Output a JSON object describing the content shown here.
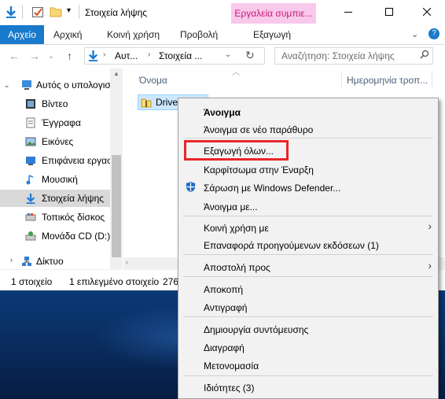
{
  "window": {
    "title": "Στοιχεία λήψης",
    "context_tab_title": "Εργαλεία συμπιε..."
  },
  "ribbon": {
    "tabs": [
      "Αρχείο",
      "Αρχική",
      "Κοινή χρήση",
      "Προβολή",
      "Εξαγωγή"
    ]
  },
  "address": {
    "path_root": "Αυτ...",
    "path_current": "Στοιχεία ...",
    "search_placeholder": "Αναζήτηση: Στοιχεία λήψης"
  },
  "nav_pane": {
    "items": [
      {
        "label": "Αυτός ο υπολογισ",
        "icon": "computer-icon"
      },
      {
        "label": "Βίντεο",
        "icon": "video-icon"
      },
      {
        "label": "Έγγραφα",
        "icon": "documents-icon"
      },
      {
        "label": "Εικόνες",
        "icon": "pictures-icon"
      },
      {
        "label": "Επιφάνεια εργασ",
        "icon": "desktop-icon"
      },
      {
        "label": "Μουσική",
        "icon": "music-icon"
      },
      {
        "label": "Στοιχεία λήψης",
        "icon": "downloads-icon"
      },
      {
        "label": "Τοπικός δίσκος",
        "icon": "disk-icon"
      },
      {
        "label": "Μονάδα CD (D:)",
        "icon": "cd-drive-icon"
      },
      {
        "label": "Δίκτυο",
        "icon": "network-icon"
      }
    ]
  },
  "columns": {
    "name": "Όνομα",
    "date": "Ημερομηνία τροπ..."
  },
  "file": {
    "name": "Drive"
  },
  "status": {
    "count": "1 στοιχείο",
    "selected": "1 επιλεγμένο στοιχείο",
    "size_fragment": "276"
  },
  "context_menu": {
    "items": [
      "Άνοιγμα",
      "Άνοιγμα σε νέο παράθυρο",
      "Εξαγωγή όλων...",
      "Καρφίτσωμα στην Έναρξη",
      "Σάρωση με Windows Defender...",
      "Άνοιγμα με...",
      "Κοινή χρήση με",
      "Επαναφορά προηγούμενων εκδόσεων (1)",
      "Αποστολή προς",
      "Αποκοπή",
      "Αντιγραφή",
      "Δημιουργία συντόμευσης",
      "Διαγραφή",
      "Μετονομασία",
      "Ιδιότητες (3)"
    ]
  },
  "colors": {
    "file_tab": "#1979ca",
    "context_tab_bg": "#f9c9ec",
    "highlight": "#e8262b",
    "selection": "#cce8ff"
  }
}
